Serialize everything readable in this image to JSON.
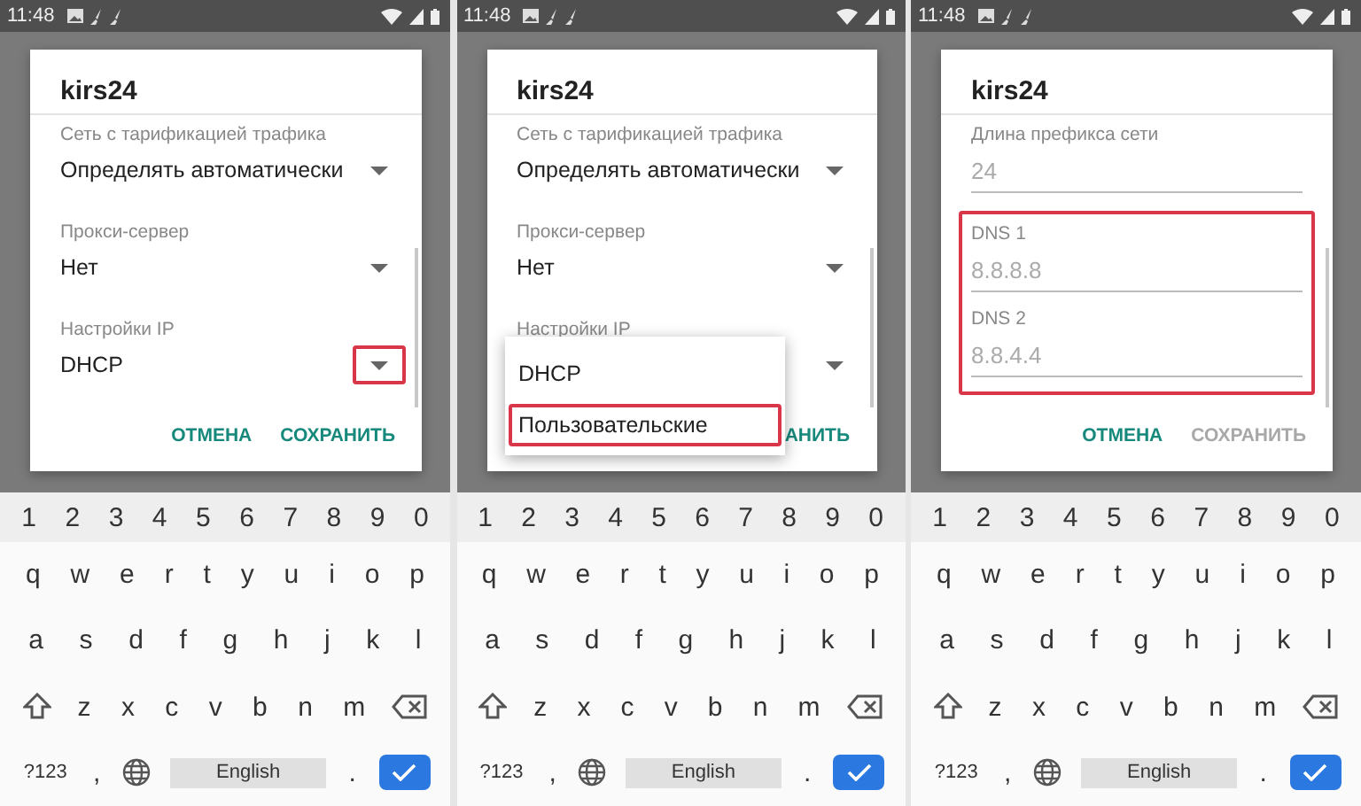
{
  "panels": [
    {
      "status": {
        "time": "11:48"
      },
      "dialog": {
        "title": "kirs24",
        "fields": [
          {
            "kind": "select",
            "label": "Сеть с тарификацией трафика",
            "value": "Определять автоматически",
            "highlighted": false
          },
          {
            "kind": "select",
            "label": "Прокси-сервер",
            "value": "Нет",
            "highlighted": false
          },
          {
            "kind": "select",
            "label": "Настройки IP",
            "value": "DHCP",
            "highlighted": true
          }
        ],
        "buttons": [
          {
            "label": "ОТМЕНА",
            "disabled": false
          },
          {
            "label": "СОХРАНИТЬ",
            "disabled": false
          }
        ]
      },
      "keyboard": {
        "number_row": [
          "1",
          "2",
          "3",
          "4",
          "5",
          "6",
          "7",
          "8",
          "9",
          "0"
        ],
        "letter_rows": [
          [
            "q",
            "w",
            "e",
            "r",
            "t",
            "y",
            "u",
            "i",
            "o",
            "p"
          ],
          [
            "a",
            "s",
            "d",
            "f",
            "g",
            "h",
            "j",
            "k",
            "l"
          ],
          [
            "z",
            "x",
            "c",
            "v",
            "b",
            "n",
            "m"
          ]
        ],
        "symbols_key": "?123",
        "comma": ",",
        "space": "English",
        "period": "."
      }
    },
    {
      "status": {
        "time": "11:48"
      },
      "dialog": {
        "title": "kirs24",
        "fields": [
          {
            "kind": "select",
            "label": "Сеть с тарификацией трафика",
            "value": "Определять автоматически",
            "highlighted": false
          },
          {
            "kind": "select",
            "label": "Прокси-сервер",
            "value": "Нет",
            "highlighted": false
          },
          {
            "kind": "select",
            "label": "Настройки IP",
            "highlighted": false
          }
        ],
        "buttons": [
          {
            "label": "АНИТЬ",
            "disabled": false
          }
        ]
      },
      "menu": {
        "options": [
          {
            "label": "DHCP",
            "highlighted": false
          },
          {
            "label": "Пользовательские",
            "highlighted": true
          }
        ]
      },
      "keyboard": {
        "number_row": [
          "1",
          "2",
          "3",
          "4",
          "5",
          "6",
          "7",
          "8",
          "9",
          "0"
        ],
        "letter_rows": [
          [
            "q",
            "w",
            "e",
            "r",
            "t",
            "y",
            "u",
            "i",
            "o",
            "p"
          ],
          [
            "a",
            "s",
            "d",
            "f",
            "g",
            "h",
            "j",
            "k",
            "l"
          ],
          [
            "z",
            "x",
            "c",
            "v",
            "b",
            "n",
            "m"
          ]
        ],
        "symbols_key": "?123",
        "comma": ",",
        "space": "English",
        "period": "."
      }
    },
    {
      "status": {
        "time": "11:48"
      },
      "dialog": {
        "title": "kirs24",
        "fields": [
          {
            "kind": "input",
            "label": "Длина префикса сети",
            "placeholder": "24"
          },
          {
            "kind": "group",
            "highlighted": true,
            "fields": [
              {
                "kind": "input",
                "label": "DNS 1",
                "placeholder": "8.8.8.8"
              },
              {
                "kind": "input",
                "label": "DNS 2",
                "placeholder": "8.8.4.4"
              }
            ]
          }
        ],
        "buttons": [
          {
            "label": "ОТМЕНА",
            "disabled": false
          },
          {
            "label": "СОХРАНИТЬ",
            "disabled": true
          }
        ]
      },
      "keyboard": {
        "number_row": [
          "1",
          "2",
          "3",
          "4",
          "5",
          "6",
          "7",
          "8",
          "9",
          "0"
        ],
        "letter_rows": [
          [
            "q",
            "w",
            "e",
            "r",
            "t",
            "y",
            "u",
            "i",
            "o",
            "p"
          ],
          [
            "a",
            "s",
            "d",
            "f",
            "g",
            "h",
            "j",
            "k",
            "l"
          ],
          [
            "z",
            "x",
            "c",
            "v",
            "b",
            "n",
            "m"
          ]
        ],
        "symbols_key": "?123",
        "comma": ",",
        "space": "English",
        "period": "."
      }
    }
  ]
}
